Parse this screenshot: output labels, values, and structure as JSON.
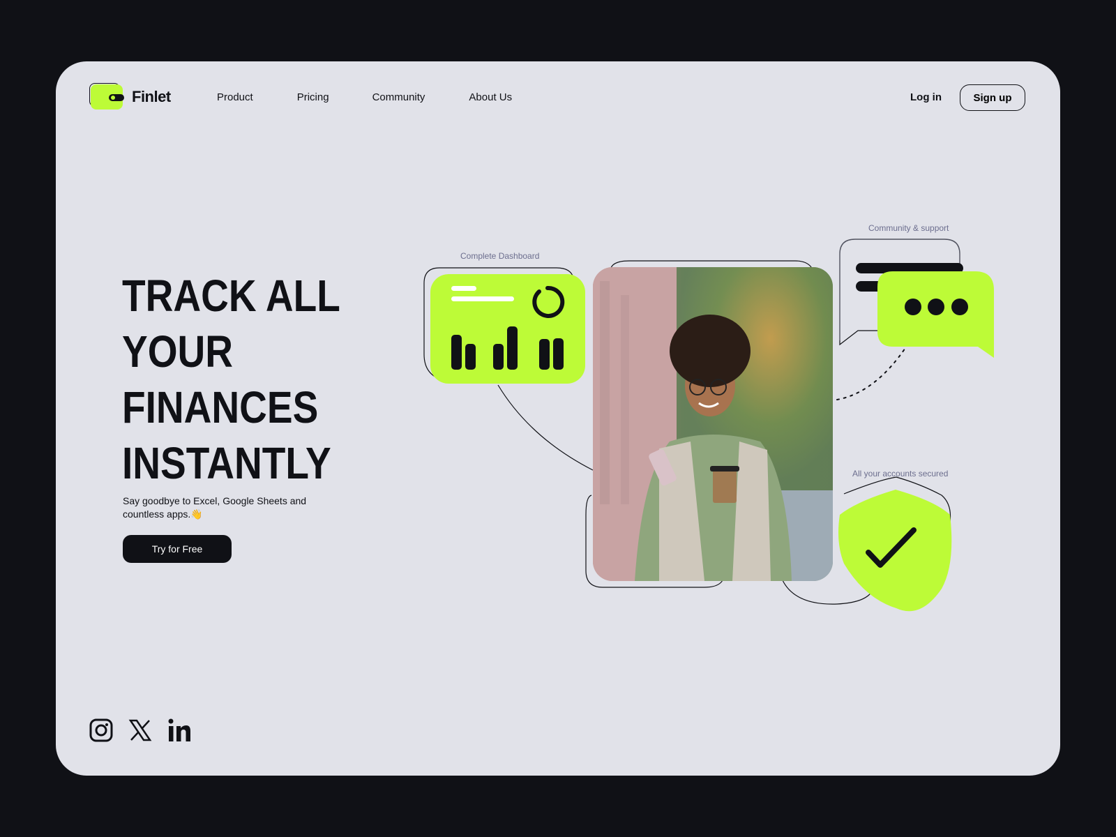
{
  "brand": {
    "name": "Finlet",
    "logo_icon": "wallet-icon",
    "accent_color": "#bdfb37",
    "dark_color": "#101116",
    "surface_color": "#e1e2e9",
    "label_color": "#6c6e8e"
  },
  "nav": {
    "items": [
      {
        "label": "Product"
      },
      {
        "label": "Pricing"
      },
      {
        "label": "Community"
      },
      {
        "label": "About Us"
      }
    ],
    "login_label": "Log in",
    "signup_label": "Sign up"
  },
  "hero": {
    "headline_lines": [
      "TRACK ALL",
      "YOUR",
      "FINANCES",
      "INSTANTLY"
    ],
    "subtitle": "Say goodbye to Excel, Google Sheets and countless apps.👋",
    "cta_label": "Try for Free"
  },
  "features": {
    "dashboard_label": "Complete Dashboard",
    "community_label": "Community & support",
    "security_label": "All your accounts secured",
    "dashboard_icon": "bar-chart-icon",
    "community_icon": "chat-bubble-icon",
    "security_icon": "shield-check-icon"
  },
  "photo": {
    "description": "Smiling woman with curly hair and glasses holding a phone and a coffee cup on a street"
  },
  "socials": [
    {
      "icon": "instagram-icon"
    },
    {
      "icon": "x-icon"
    },
    {
      "icon": "linkedin-icon"
    }
  ]
}
